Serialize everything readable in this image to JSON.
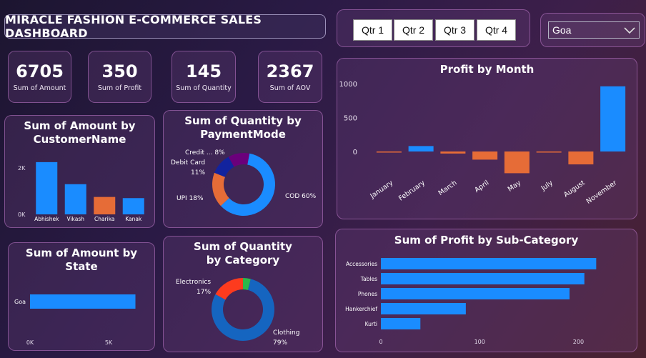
{
  "header": {
    "title": "MIRACLE FASHION E-COMMERCE SALES DASHBOARD"
  },
  "quarters": [
    "Qtr 1",
    "Qtr 2",
    "Qtr 3",
    "Qtr 4"
  ],
  "state_filter": {
    "selected": "Goa"
  },
  "kpis": [
    {
      "value": "6705",
      "label": "Sum of Amount"
    },
    {
      "value": "350",
      "label": "Sum of Profit"
    },
    {
      "value": "145",
      "label": "Sum of Quantity"
    },
    {
      "value": "2367",
      "label": "Sum of AOV"
    }
  ],
  "colors": {
    "blue": "#1a8cff",
    "orange": "#e66c37",
    "navy": "#12239e",
    "purple": "#6b007b",
    "red": "#fd3b1e",
    "green": "#2bb84b",
    "donut_blue": "#1565c0"
  },
  "chart_data": [
    {
      "id": "amount_by_customer",
      "type": "bar",
      "title": "Sum of Amount by CustomerName",
      "categories": [
        "Abhishek",
        "Vikash",
        "Charika",
        "Kanak"
      ],
      "values": [
        2250,
        1300,
        750,
        700
      ],
      "ylim": [
        0,
        2400
      ],
      "yticks": [
        {
          "value": 0,
          "label": "0K"
        },
        {
          "value": 2000,
          "label": "2K"
        }
      ],
      "bar_colors": [
        "#1a8cff",
        "#1a8cff",
        "#e66c37",
        "#1a8cff"
      ]
    },
    {
      "id": "quantity_by_paymentmode",
      "type": "pie",
      "title": "Sum of Quantity by PaymentMode",
      "slices": [
        {
          "label": "COD 60%",
          "value": 60,
          "color": "#1a8cff"
        },
        {
          "label": "UPI 18%",
          "value": 18,
          "color": "#e66c37"
        },
        {
          "label": "Debit Card 11%",
          "value": 11,
          "color": "#12239e"
        },
        {
          "label": "Credit ... 8%",
          "value": 8,
          "color": "#6b007b"
        },
        {
          "label": "",
          "value": 3,
          "color": "#6b007b"
        }
      ]
    },
    {
      "id": "amount_by_state",
      "type": "bar",
      "orientation": "horizontal",
      "title": "Sum of Amount by State",
      "categories": [
        "Goa"
      ],
      "values": [
        6705
      ],
      "xlim": [
        0,
        7500
      ],
      "xticks": [
        {
          "value": 0,
          "label": "0K"
        },
        {
          "value": 5000,
          "label": "5K"
        }
      ]
    },
    {
      "id": "quantity_by_category",
      "type": "pie",
      "title": "Sum of Quantity by Category",
      "slices": [
        {
          "label": "Clothing 79%",
          "value": 79,
          "color": "#1565c0"
        },
        {
          "label": "Electronics 17%",
          "value": 17,
          "color": "#fd3b1e"
        },
        {
          "label": "",
          "value": 4,
          "color": "#2bb84b"
        }
      ]
    },
    {
      "id": "profit_by_month",
      "type": "bar",
      "title": "Profit by Month",
      "categories": [
        "January",
        "February",
        "March",
        "April",
        "May",
        "July",
        "August",
        "November"
      ],
      "values": [
        -10,
        80,
        -30,
        -120,
        -320,
        -15,
        -190,
        960
      ],
      "ylim": [
        -400,
        1000
      ],
      "yticks": [
        0,
        500,
        1000
      ],
      "positive_color": "#1a8cff",
      "negative_color": "#e66c37"
    },
    {
      "id": "profit_by_subcategory",
      "type": "bar",
      "orientation": "horizontal",
      "title": "Sum of Profit by Sub-Category",
      "categories": [
        "Accessories",
        "Tables",
        "Phones",
        "Hankerchief",
        "Kurti"
      ],
      "values": [
        218,
        206,
        191,
        86,
        40
      ],
      "xlim": [
        0,
        225
      ],
      "xticks": [
        0,
        100,
        200
      ]
    }
  ]
}
